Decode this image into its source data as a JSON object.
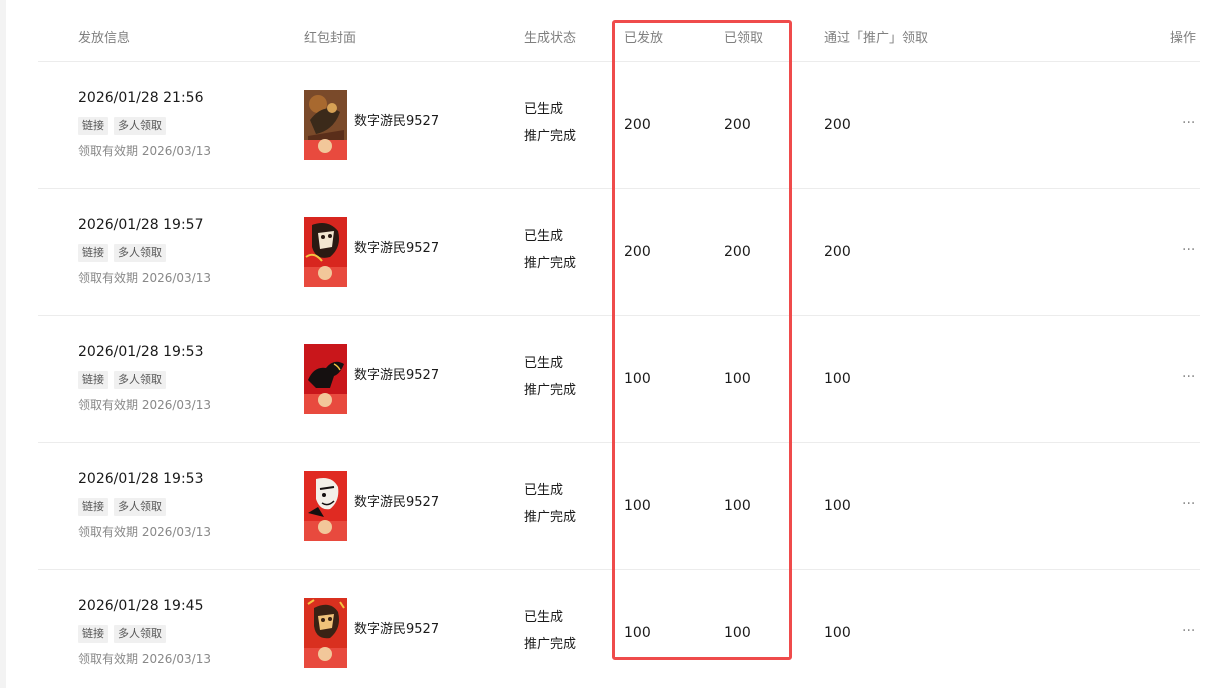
{
  "headers": {
    "info": "发放信息",
    "cover": "红包封面",
    "status": "生成状态",
    "issued": "已发放",
    "claimed": "已领取",
    "via_promo": "通过「推广」领取",
    "actions": "操作"
  },
  "rows": [
    {
      "datetime": "2026/01/28 21:56",
      "tag_link": "链接",
      "tag_multi": "多人领取",
      "expiry": "领取有效期 2026/03/13",
      "cover_name": "数字游民9527",
      "status_generated": "已生成",
      "status_promo": "推广完成",
      "issued": "200",
      "claimed": "200",
      "via_promo": "200",
      "more": "···",
      "cover_colors": {
        "bg": "#7a4a2a",
        "accent": "#3b2a1a"
      }
    },
    {
      "datetime": "2026/01/28 19:57",
      "tag_link": "链接",
      "tag_multi": "多人领取",
      "expiry": "领取有效期 2026/03/13",
      "cover_name": "数字游民9527",
      "status_generated": "已生成",
      "status_promo": "推广完成",
      "issued": "200",
      "claimed": "200",
      "via_promo": "200",
      "more": "···",
      "cover_colors": {
        "bg": "#d8261f",
        "accent": "#2a1a12"
      }
    },
    {
      "datetime": "2026/01/28 19:53",
      "tag_link": "链接",
      "tag_multi": "多人领取",
      "expiry": "领取有效期 2026/03/13",
      "cover_name": "数字游民9527",
      "status_generated": "已生成",
      "status_promo": "推广完成",
      "issued": "100",
      "claimed": "100",
      "via_promo": "100",
      "more": "···",
      "cover_colors": {
        "bg": "#c9161b",
        "accent": "#151010"
      }
    },
    {
      "datetime": "2026/01/28 19:53",
      "tag_link": "链接",
      "tag_multi": "多人领取",
      "expiry": "领取有效期 2026/03/13",
      "cover_name": "数字游民9527",
      "status_generated": "已生成",
      "status_promo": "推广完成",
      "issued": "100",
      "claimed": "100",
      "via_promo": "100",
      "more": "···",
      "cover_colors": {
        "bg": "#e02a22",
        "accent": "#f3efe8"
      }
    },
    {
      "datetime": "2026/01/28 19:45",
      "tag_link": "链接",
      "tag_multi": "多人领取",
      "expiry": "领取有效期 2026/03/13",
      "cover_name": "数字游民9527",
      "status_generated": "已生成",
      "status_promo": "推广完成",
      "issued": "100",
      "claimed": "100",
      "via_promo": "100",
      "more": "···",
      "cover_colors": {
        "bg": "#d9301f",
        "accent": "#3a2214"
      }
    }
  ],
  "highlight_color": "#ef4b4b"
}
